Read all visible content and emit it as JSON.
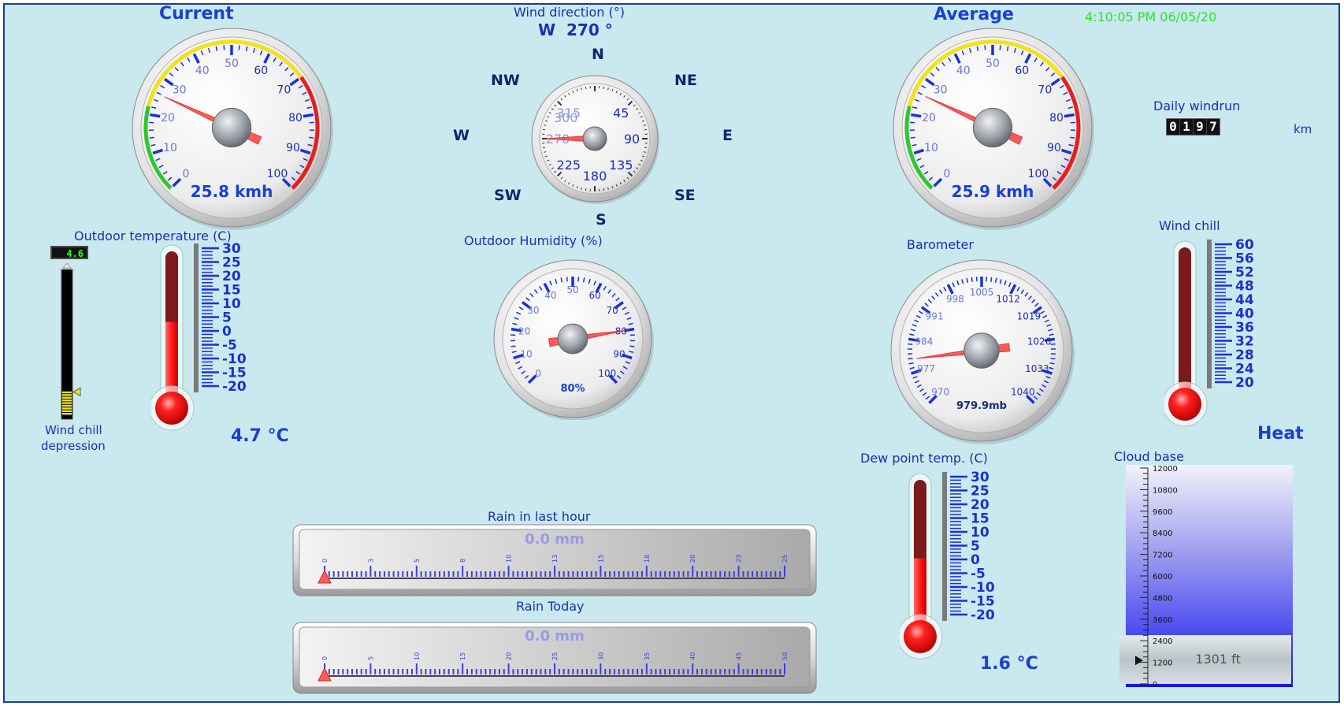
{
  "timestamp": "4:10:05 PM 06/05/20",
  "colors": {
    "label": "#1a2fb4",
    "title": "#1a3fd4",
    "timestamp": "#2fe02f",
    "needle": "#ff5a5a",
    "mercury": "#ff1a1a"
  },
  "current_wind": {
    "title": "Current",
    "readout": "25.8 kmh",
    "value": 25.8,
    "min": 0,
    "max": 100,
    "ticks": [
      "0",
      "10",
      "20",
      "30",
      "40",
      "50",
      "60",
      "70",
      "80",
      "90",
      "100"
    ]
  },
  "average_wind": {
    "title": "Average",
    "readout": "25.9 kmh",
    "value": 25.9,
    "min": 0,
    "max": 100,
    "ticks": [
      "0",
      "10",
      "20",
      "30",
      "40",
      "50",
      "60",
      "70",
      "80",
      "90",
      "100"
    ]
  },
  "wind_direction": {
    "label": "Wind direction (°)",
    "readout": "W  270 °",
    "degrees": 270,
    "points": {
      "n": "N",
      "ne": "NE",
      "e": "E",
      "se": "SE",
      "s": "S",
      "sw": "SW",
      "w": "W",
      "nw": "NW"
    },
    "dial_labels": [
      "45",
      "90",
      "135",
      "180",
      "225",
      "270",
      "315",
      "300"
    ]
  },
  "humidity": {
    "label": "Outdoor Humidity (%)",
    "readout": "80%",
    "value": 80,
    "min": 0,
    "max": 100,
    "ticks": [
      "0",
      "10",
      "20",
      "30",
      "40",
      "50",
      "60",
      "70",
      "80",
      "90",
      "100"
    ]
  },
  "barometer": {
    "label": "Barometer",
    "readout": "979.9mb",
    "value": 979.9,
    "min": 970,
    "max": 1040,
    "ticks": [
      "970",
      "977",
      "984",
      "991",
      "998",
      "1005",
      "1012",
      "1019",
      "1026",
      "1033",
      "1040"
    ]
  },
  "outdoor_temp": {
    "label": "Outdoor temperature (C)",
    "readout": "4.7 °C",
    "value": 4.7,
    "min": -20,
    "max": 30,
    "scale": [
      "30",
      "25",
      "20",
      "15",
      "10",
      "5",
      "0",
      "-5",
      "-10",
      "-15",
      "-20"
    ]
  },
  "wind_chill_depression": {
    "label_line1": "Wind chill",
    "label_line2": "depression",
    "value_text": "4.6",
    "value": 4.6
  },
  "dew_point": {
    "label": "Dew point temp. (C)",
    "readout": "1.6 °C",
    "value": 1.6,
    "min": -20,
    "max": 30,
    "scale": [
      "30",
      "25",
      "20",
      "15",
      "10",
      "5",
      "0",
      "-5",
      "-10",
      "-15",
      "-20"
    ]
  },
  "wind_chill": {
    "label": "Wind chill",
    "heat_label": "Heat",
    "value": 4.7,
    "min": 20,
    "max": 60,
    "scale": [
      "60",
      "56",
      "52",
      "48",
      "44",
      "40",
      "36",
      "32",
      "28",
      "24",
      "20"
    ]
  },
  "daily_windrun": {
    "label": "Daily windrun",
    "digits": [
      "0",
      "1",
      "9",
      "7"
    ],
    "unit": "km"
  },
  "rain_hour": {
    "label": "Rain in last hour",
    "readout": "0.0 mm",
    "value": 0.0,
    "ticks": [
      "0",
      "3",
      "5",
      "8",
      "10",
      "13",
      "15",
      "18",
      "20",
      "23",
      "25"
    ]
  },
  "rain_today": {
    "label": "Rain Today",
    "readout": "0.0 mm",
    "value": 0.0,
    "ticks": [
      "0",
      "5",
      "10",
      "15",
      "20",
      "25",
      "30",
      "35",
      "40",
      "45",
      "50"
    ]
  },
  "cloud_base": {
    "label": "Cloud base",
    "readout": "1301 ft",
    "value": 1301,
    "min": 0,
    "max": 12000,
    "ticks": [
      "12000",
      "10800",
      "9600",
      "8400",
      "7200",
      "6000",
      "4800",
      "3600",
      "2400",
      "1200",
      "0"
    ]
  }
}
